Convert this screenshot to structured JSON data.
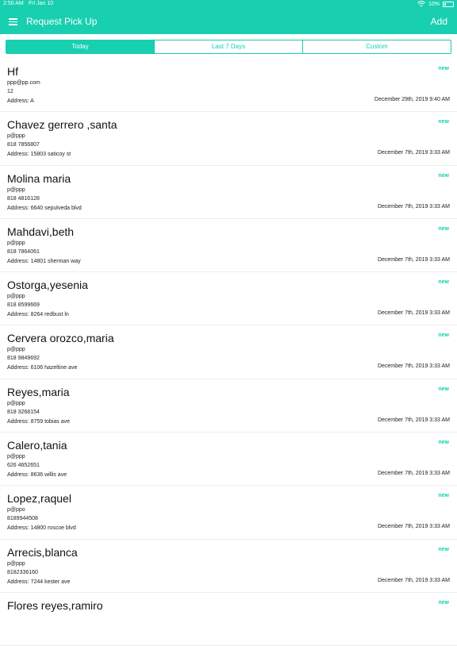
{
  "status_bar": {
    "time": "2:50 AM",
    "date": "Fri Jan 10",
    "battery": "10%"
  },
  "header": {
    "title": "Request Pick Up",
    "add_label": "Add"
  },
  "tabs": [
    {
      "label": "Today"
    },
    {
      "label": "Last 7 Days"
    },
    {
      "label": "Custom"
    }
  ],
  "items": [
    {
      "name": "Hf",
      "email": "ppp@pp.com",
      "phone": "12",
      "address": "Address: A",
      "date": "December 29th, 2019 9:40 AM",
      "badge": "new"
    },
    {
      "name": "Chavez gerrero ,santa",
      "email": "p@ppp",
      "phone": "818 7856807",
      "address": "Address: 15803 saticoy st",
      "date": "December 7th, 2019 3:33 AM",
      "badge": "new"
    },
    {
      "name": "Molina maria",
      "email": "p@ppp",
      "phone": "818 4816128",
      "address": "Address: 6640 sepulveda blvd",
      "date": "December 7th, 2019 3:33 AM",
      "badge": "new"
    },
    {
      "name": "Mahdavi,beth",
      "email": "p@ppp",
      "phone": "818 7864061",
      "address": "Address: 14801 sherman way",
      "date": "December 7th, 2019 3:33 AM",
      "badge": "new"
    },
    {
      "name": "Ostorga,yesenia",
      "email": "p@ppp",
      "phone": "818 8599669",
      "address": "Address: 8264 redbust ln",
      "date": "December 7th, 2019 3:33 AM",
      "badge": "new"
    },
    {
      "name": "Cervera orozco,maria",
      "email": "p@ppp",
      "phone": "818 9849692",
      "address": "Address: 6106 hazeltine ave",
      "date": "December 7th, 2019 3:33 AM",
      "badge": "new"
    },
    {
      "name": "Reyes,maria",
      "email": "p@ppp",
      "phone": "818 3268154",
      "address": "Address: 8759 tobias ave",
      "date": "December 7th, 2019 3:33 AM",
      "badge": "new"
    },
    {
      "name": "Calero,tania",
      "email": "p@ppp",
      "phone": "626 4652651",
      "address": "Address: 8636 willis ave",
      "date": "December 7th, 2019 3:33 AM",
      "badge": "new"
    },
    {
      "name": "Lopez,raquel",
      "email": "p@ppo",
      "phone": "8189944508",
      "address": "Address: 14800 roscoe blvd",
      "date": "December 7th, 2019 3:33 AM",
      "badge": "new"
    },
    {
      "name": "Arrecis,blanca",
      "email": "p@ppp",
      "phone": "8182336160",
      "address": "Address: 7244 kester ave",
      "date": "December 7th, 2019 3:33 AM",
      "badge": "new"
    },
    {
      "name": "Flores reyes,ramiro",
      "email": "",
      "phone": "",
      "address": "",
      "date": "",
      "badge": "new"
    }
  ],
  "colors": {
    "accent": "#18cfb0"
  }
}
